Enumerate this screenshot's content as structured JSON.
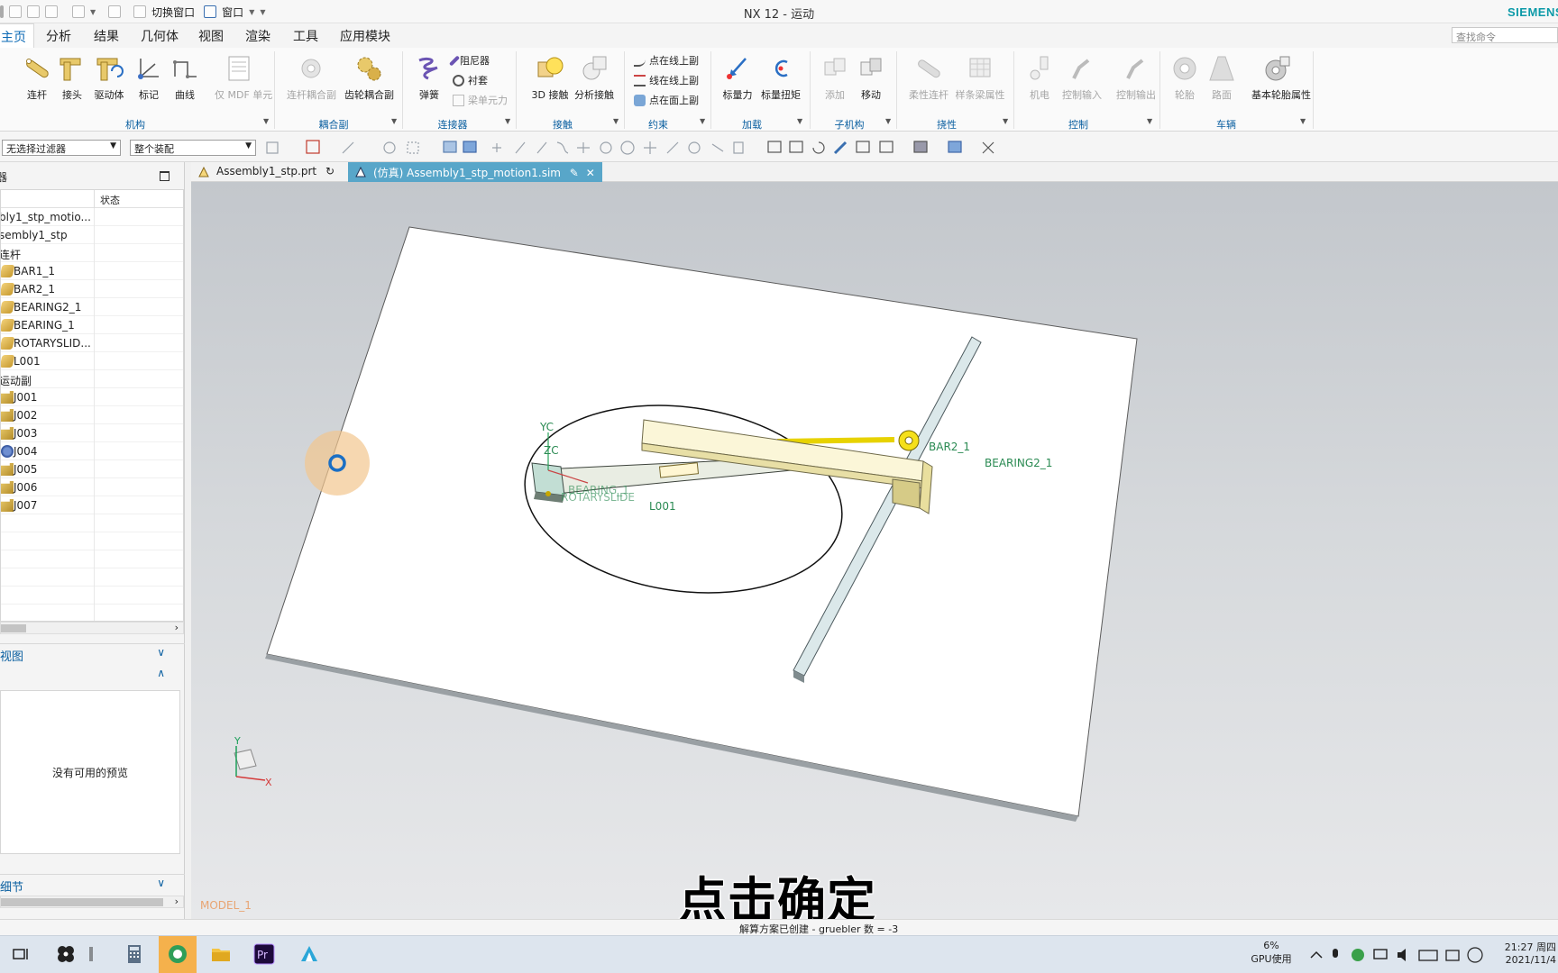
{
  "titlebar": {
    "title": "NX 12 - 运动",
    "brand": "SIEMENS",
    "switch_window": "切换窗口",
    "window_menu": "窗口"
  },
  "menu": {
    "tabs": [
      "主页",
      "分析",
      "结果",
      "几何体",
      "视图",
      "渲染",
      "工具",
      "应用模块"
    ],
    "search_placeholder": "查找命令"
  },
  "ribbon": {
    "buttons": {
      "link": "连杆",
      "joint": "接头",
      "driver": "驱动体",
      "marker": "标记",
      "curve": "曲线",
      "mdf": "仅 MDF 单元",
      "link_coupler": "连杆耦合副",
      "gear_coupler": "齿轮耦合副",
      "spring": "弹簧",
      "damper": "阻尼器",
      "bushing": "衬套",
      "beam_force": "梁单元力",
      "contact_3d": "3D 接触",
      "analytic_contact": "分析接触",
      "point_on_curve": "点在线上副",
      "curve_on_curve": "线在线上副",
      "point_on_surface": "点在面上副",
      "scalar_force": "标量力",
      "scalar_torque": "标量扭矩",
      "add": "添加",
      "move": "移动",
      "flexible_link": "柔性连杆",
      "spline_beam": "样条梁属性",
      "motor": "机电",
      "control_input": "控制输入",
      "control_output": "控制输出",
      "tire": "轮胎",
      "road": "路面",
      "tire_props": "基本轮胎属性"
    },
    "groups": {
      "mechanism": "机构",
      "coupler": "耦合副",
      "connector": "连接器",
      "contact": "接触",
      "constraint": "约束",
      "load": "加载",
      "submechanism": "子机构",
      "flexible": "挠性",
      "control": "控制",
      "vehicle": "车辆"
    }
  },
  "toolbar": {
    "filter": "无选择过滤器",
    "assembly_scope": "整个装配"
  },
  "navigator": {
    "title": "器",
    "status_col": "状态",
    "rows": [
      {
        "label": "bly1_stp_motio..."
      },
      {
        "label": "sembly1_stp"
      },
      {
        "label": "连杆"
      },
      {
        "label": "BAR1_1"
      },
      {
        "label": "BAR2_1"
      },
      {
        "label": "BEARING2_1"
      },
      {
        "label": "BEARING_1"
      },
      {
        "label": "ROTARYSLID..."
      },
      {
        "label": "L001"
      },
      {
        "label": "运动副"
      },
      {
        "label": "J001"
      },
      {
        "label": "J002"
      },
      {
        "label": "J003"
      },
      {
        "label": "J004"
      },
      {
        "label": "J005"
      },
      {
        "label": "J006"
      },
      {
        "label": "J007"
      }
    ],
    "section_view": "视图",
    "preview_empty": "没有可用的预览",
    "section_details": "细节"
  },
  "doc_tabs": {
    "tab1": "Assembly1_stp.prt",
    "tab2": "(仿真) Assembly1_stp_motion1.sim"
  },
  "viewport": {
    "model_label": "MODEL_1",
    "labels": {
      "yc": "YC",
      "zc": "ZC",
      "bar2": "BAR2_1",
      "bearing2": "BEARING2_1",
      "l001": "L001",
      "rotary": "ROTARYSLIDE",
      "bearing": "BEARING_1",
      "axis_x": "X",
      "axis_y": "Y"
    },
    "subtitle": "点击确定"
  },
  "status": {
    "message": "解算方案已创建 - gruebler 数 = -3"
  },
  "taskbar": {
    "gpu_percent": "6%",
    "gpu_label": "GPU使用",
    "time": "21:27 周四",
    "date": "2021/11/4"
  },
  "colors": {
    "accent": "#0a68b4",
    "active_tab": "#58a6c9",
    "taskbar_active": "#f5b14c",
    "brand": "#0c9aa8"
  }
}
